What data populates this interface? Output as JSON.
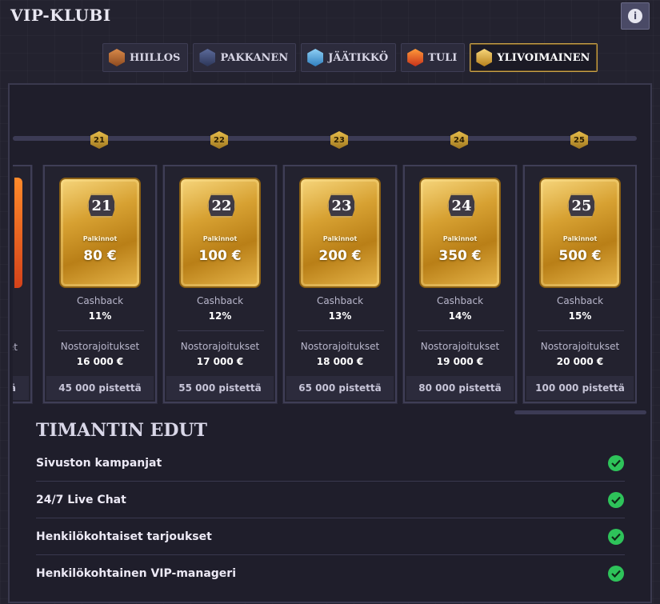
{
  "header": {
    "title": "VIP-KLUBI",
    "info_icon": "info-icon"
  },
  "tabs": [
    {
      "label": "HIILLOS",
      "color": "#b8652f",
      "active": false
    },
    {
      "label": "PAKKANEN",
      "color": "#3f4d7a",
      "active": false
    },
    {
      "label": "JÄÄTIKKÖ",
      "color": "#4a9fd6",
      "active": false
    },
    {
      "label": "TULI",
      "color": "#e8541c",
      "active": false
    },
    {
      "label": "YLIVOIMAINEN",
      "color": "#e0a72e",
      "active": true
    }
  ],
  "partial_card": {
    "line1": "et",
    "line2": "ä"
  },
  "levels": [
    {
      "level": "21",
      "reward_label": "Palkinnot",
      "reward": "80 €",
      "cashback_label": "Cashback",
      "cashback": "11%",
      "limit_label": "Nostorajoitukset",
      "limit": "16 000 €",
      "points": "45 000 pistettä"
    },
    {
      "level": "22",
      "reward_label": "Palkinnot",
      "reward": "100 €",
      "cashback_label": "Cashback",
      "cashback": "12%",
      "limit_label": "Nostorajoitukset",
      "limit": "17 000 €",
      "points": "55 000 pistettä"
    },
    {
      "level": "23",
      "reward_label": "Palkinnot",
      "reward": "200 €",
      "cashback_label": "Cashback",
      "cashback": "13%",
      "limit_label": "Nostorajoitukset",
      "limit": "18 000 €",
      "points": "65 000 pistettä"
    },
    {
      "level": "24",
      "reward_label": "Palkinnot",
      "reward": "350 €",
      "cashback_label": "Cashback",
      "cashback": "14%",
      "limit_label": "Nostorajoitukset",
      "limit": "19 000 €",
      "points": "80 000 pistettä"
    },
    {
      "level": "25",
      "reward_label": "Palkinnot",
      "reward": "500 €",
      "cashback_label": "Cashback",
      "cashback": "15%",
      "limit_label": "Nostorajoitukset",
      "limit": "20 000 €",
      "points": "100 000 pistettä"
    }
  ],
  "benefits": {
    "title": "TIMANTIN EDUT",
    "items": [
      {
        "label": "Sivuston kampanjat",
        "included": true
      },
      {
        "label": "24/7 Live Chat",
        "included": true
      },
      {
        "label": "Henkilökohtaiset tarjoukset",
        "included": true
      },
      {
        "label": "Henkilökohtainen VIP-manageri",
        "included": true
      }
    ],
    "check_color": "#2ec35a"
  }
}
